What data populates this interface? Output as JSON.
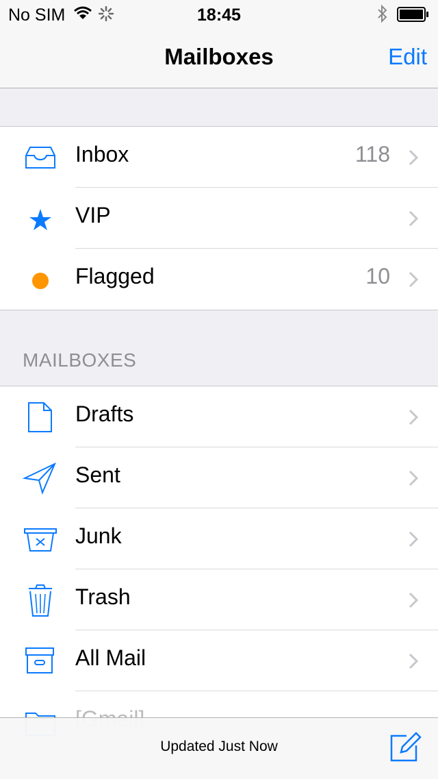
{
  "status_bar": {
    "carrier": "No SIM",
    "time": "18:45"
  },
  "nav": {
    "title": "Mailboxes",
    "edit_label": "Edit"
  },
  "smart_mailboxes": [
    {
      "label": "Inbox",
      "count": "118",
      "icon": "inbox-tray-icon"
    },
    {
      "label": "VIP",
      "count": "",
      "icon": "star-icon"
    },
    {
      "label": "Flagged",
      "count": "10",
      "icon": "flag-dot-icon"
    }
  ],
  "section_header": "MAILBOXES",
  "mailboxes": [
    {
      "label": "Drafts",
      "icon": "document-icon"
    },
    {
      "label": "Sent",
      "icon": "paper-plane-icon"
    },
    {
      "label": "Junk",
      "icon": "junk-bin-icon"
    },
    {
      "label": "Trash",
      "icon": "trash-icon"
    },
    {
      "label": "All Mail",
      "icon": "archive-box-icon"
    },
    {
      "label": "[Gmail]",
      "icon": "folder-icon"
    }
  ],
  "toolbar": {
    "status": "Updated Just Now"
  },
  "colors": {
    "accent": "#0a7aff",
    "flag": "#ff9500",
    "background": "#efeff4"
  }
}
